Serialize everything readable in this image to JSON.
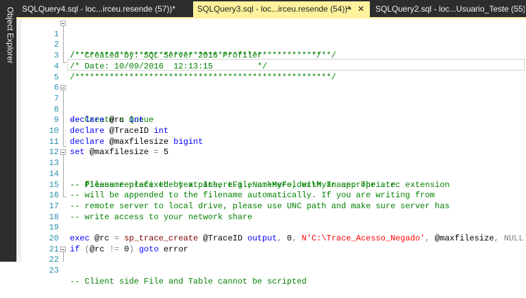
{
  "sidebar": {
    "label": "Object Explorer"
  },
  "tabs": [
    {
      "label": "SQLQuery4.sql - loc...irceu.resende (57))*",
      "active": false
    },
    {
      "label": "SQLQuery3.sql - loc...irceu.resende (54))*",
      "active": true,
      "pin_icon": "pin-icon",
      "close_icon": "close-icon"
    },
    {
      "label": "SQLQuery2.sql - loc...Usuario_Teste (55))*",
      "active": false
    }
  ],
  "editor": {
    "line_numbers": [
      "1",
      "2",
      "3",
      "4",
      "5",
      "6",
      "7",
      "8",
      "9",
      "10",
      "11",
      "12",
      "13",
      "14",
      "15",
      "16",
      "17",
      "18",
      "19",
      "20",
      "21",
      "22",
      "23"
    ],
    "lines": {
      "l1": "/****************************************************/",
      "l2": "/* Created by: SQL Server 2016 Profiler          */",
      "l3": "/* Date: 10/09/2016  12:13:15         */",
      "l4": "/****************************************************/",
      "l7": "-- Create a Queue",
      "l8_kw": "declare",
      "l8_var": " @rc ",
      "l8_type": "int",
      "l9_kw": "declare",
      "l9_var": " @TraceID ",
      "l9_type": "int",
      "l10_kw": "declare",
      "l10_var": " @maxfilesize ",
      "l10_type": "bigint",
      "l11_kw": "set",
      "l11_var": " @maxfilesize ",
      "l11_op": "=",
      "l11_val": " 5",
      "l13": "-- Please replace the text InsertFileNameHere, with an appropriate",
      "l14": "-- filename prefixed by a path, e.g., c:\\MyFolder\\MyTrace. The .trc extension",
      "l15": "-- will be appended to the filename automatically. If you are writing from",
      "l16": "-- remote server to local drive, please use UNC path and make sure server has",
      "l17": "-- write access to your network share",
      "l19_kw1": "exec",
      "l19_var": " @rc ",
      "l19_op": "=",
      "l19_sp": " sp_trace_create",
      "l19_arg1": " @TraceID ",
      "l19_kw2": "output",
      "l19_c1": ",",
      "l19_n": " 0",
      "l19_c2": ", ",
      "l19_str": "N'C:\\Trace_Acesso_Negado'",
      "l19_c3": ",",
      "l19_arg2": " @maxfilesize",
      "l19_c4": ", ",
      "l19_null": "NULL",
      "l20_kw": "if",
      "l20_p1": " (",
      "l20_var": "@rc ",
      "l20_op": "!=",
      "l20_n": " 0",
      "l20_p2": ")",
      "l20_kw2": " goto",
      "l20_lbl": " error",
      "l22": "-- Client side File and Table cannot be scripted"
    }
  },
  "colors": {
    "active_tab": "#fff29d",
    "tabstrip_bg": "#2d2d30",
    "line_number": "#2b91af",
    "keyword": "#0000ff",
    "comment": "#008000",
    "string": "#ff0000",
    "system_proc": "#800000",
    "operator": "#808080"
  }
}
